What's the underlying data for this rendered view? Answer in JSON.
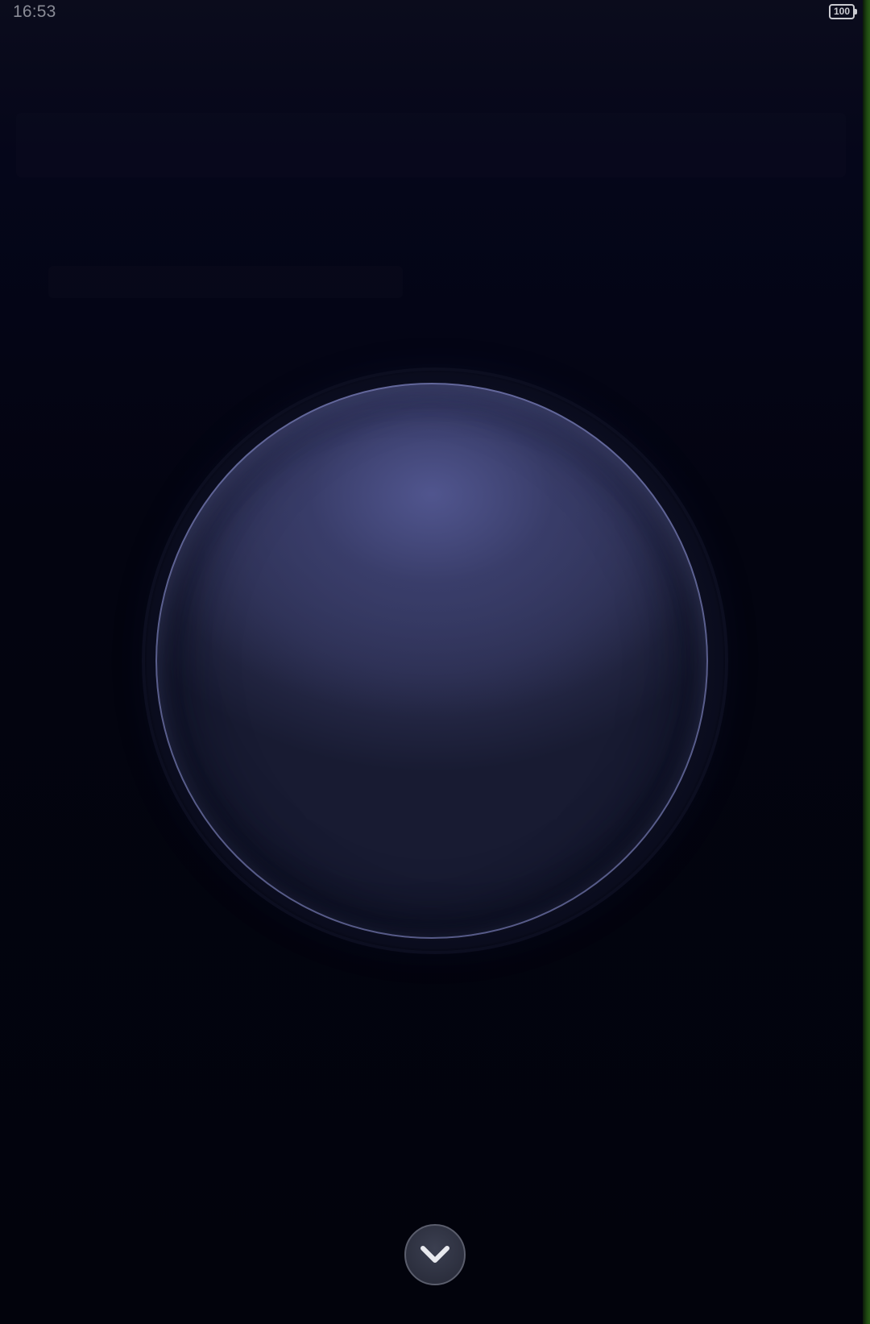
{
  "status_bar": {
    "time": "16:53",
    "battery_level": "100"
  },
  "controls": {
    "scroll_down_icon": "chevron-down-icon"
  },
  "colors": {
    "background": "#03040f",
    "orb_top": "#3b3f66",
    "orb_bottom": "#10122a",
    "button_fill": "#2c2f3e",
    "status_text": "#8a8c96",
    "edge_strip": "#2a5a16"
  }
}
